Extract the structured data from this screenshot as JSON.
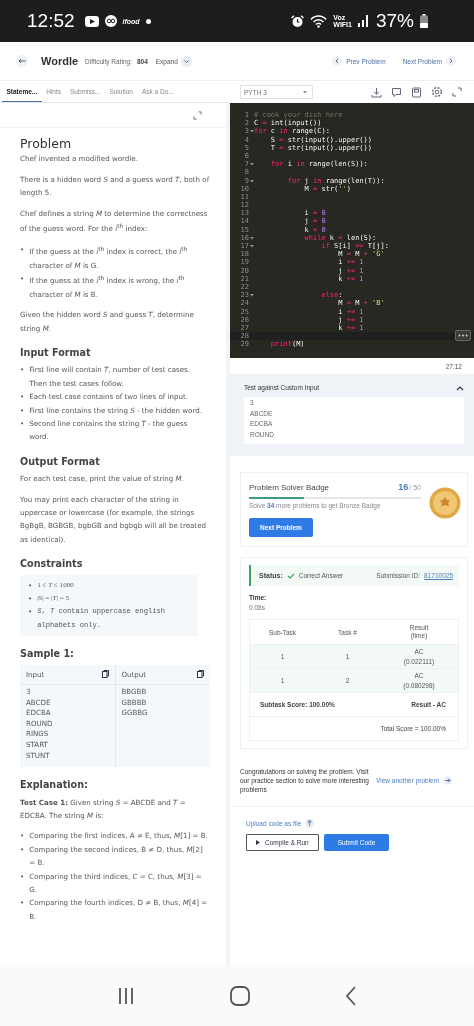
{
  "status_bar": {
    "time": "12:52",
    "notification_logo": "ifood",
    "carrier_top": "Voz",
    "carrier_bottom": "WIFI1",
    "battery": "37%"
  },
  "header": {
    "title": "Wordle",
    "difficulty_label": "Difficulty Rating:",
    "difficulty": "804",
    "expand": "Expand",
    "prev": "Prev Problem",
    "next": "Next Problem"
  },
  "tabs": [
    {
      "label": "Stateme...",
      "selected": true
    },
    {
      "label": "Hints",
      "selected": false
    },
    {
      "label": "Submiss...",
      "selected": false
    },
    {
      "label": "Solution",
      "selected": false
    },
    {
      "label": "Ask a Do...",
      "selected": false
    }
  ],
  "language": "PYTH 3",
  "statement": [
    {
      "kind": "title",
      "text": "Problem"
    },
    {
      "kind": "para",
      "text": "Chef invented a modified wordle."
    },
    {
      "kind": "para",
      "text": "There is a hidden word *S* and a guess word *T*, both of length 5."
    },
    {
      "kind": "para",
      "text": "Chef defines a string *M* to determine the correctness of the guess word. For the *i*$^{th}$ index:"
    },
    {
      "kind": "bullets",
      "marker": "•",
      "items": [
        "If the guess at the *i*$^{th}$ index is correct, the *i*$^{th}$ character of *M* is G.",
        "If the guess at the *i*$^{th}$ index is wrong, the *i*$^{th}$ character of *M* is B."
      ]
    },
    {
      "kind": "para",
      "text": "Given the hidden word *S* and guess *T*, determine string *M*."
    },
    {
      "kind": "heading",
      "text": "Input Format"
    },
    {
      "kind": "bullets",
      "marker": "•",
      "items": [
        "First line will contain *T*, number of test cases. Then the test cases follow.",
        "Each test case contains of two lines of input.",
        "First line contains the string *S* - the hidden word.",
        "Second line contains the string *T* - the guess word."
      ]
    },
    {
      "kind": "heading",
      "text": "Output Format"
    },
    {
      "kind": "para",
      "text": "For each test case, print the value of string *M*."
    },
    {
      "kind": "para",
      "text": "You may print each character of the string in uppercase or lowercase (for example, the strings BgBgB, BGBGB, bgbGB and bgbgb will all be treated as identical)."
    },
    {
      "kind": "heading",
      "text": "Constraints"
    },
    {
      "kind": "constraints",
      "marker": "•",
      "items": [
        {
          "kind": "math",
          "text": "1 ≤ *T* ≤ 1000"
        },
        {
          "kind": "math",
          "text": "|*S*| = |*T*| = 5"
        },
        {
          "kind": "code",
          "text": "*S*, *T* contain uppercase english alphabets only."
        }
      ]
    },
    {
      "kind": "heading",
      "text": "Sample 1:"
    },
    {
      "kind": "sample",
      "input_label": "Input",
      "output_label": "Output",
      "input": [
        "3",
        "ABCDE",
        "EDCBA",
        "ROUND",
        "RINGS",
        "START",
        "STUNT"
      ],
      "output": [
        "BBGBB",
        "GBBBB",
        "GGBBG"
      ]
    },
    {
      "kind": "heading",
      "text": "Explanation:"
    },
    {
      "kind": "para",
      "text": "**Test Case 1:** Given string *S* = ABCDE and *T* = EDCBA. The string *M* is:"
    },
    {
      "kind": "bullets",
      "marker": "•",
      "items": [
        "Comparing the first indices, A ≠ E, thus, *M*[1] = B.",
        "Comparing the second indices, B ≠ D, thus, *M*[2] = B.",
        "Comparing the third indices, C = C, thus, *M*[3] = G.",
        "Comparing the fourth indices, D ≠ B, thus, *M*[4] = B."
      ]
    }
  ],
  "code": [
    {
      "n": "1",
      "tokens": [
        {
          "text": "# cook your dish here",
          "kind": "comment"
        }
      ]
    },
    {
      "n": "2",
      "tokens": [
        {
          "text": "C ",
          "kind": "name"
        },
        {
          "text": "=",
          "kind": "operator"
        },
        {
          "text": " int(input())",
          "kind": "name"
        }
      ]
    },
    {
      "n": "3",
      "fold": true,
      "tokens": [
        {
          "text": "for",
          "kind": "keyword"
        },
        {
          "text": " c ",
          "kind": "name"
        },
        {
          "text": "in",
          "kind": "keyword"
        },
        {
          "text": " range(C):",
          "kind": "name"
        }
      ]
    },
    {
      "n": "4",
      "tokens": [
        {
          "text": "    S ",
          "kind": "name"
        },
        {
          "text": "=",
          "kind": "operator"
        },
        {
          "text": " str(input().upper())",
          "kind": "name"
        }
      ]
    },
    {
      "n": "5",
      "tokens": [
        {
          "text": "    T ",
          "kind": "name"
        },
        {
          "text": "=",
          "kind": "operator"
        },
        {
          "text": " str(input().upper())",
          "kind": "name"
        }
      ]
    },
    {
      "n": "6"
    },
    {
      "n": "7",
      "fold": true,
      "tokens": [
        {
          "text": "    for",
          "kind": "keyword"
        },
        {
          "text": " i ",
          "kind": "name"
        },
        {
          "text": "in",
          "kind": "keyword"
        },
        {
          "text": " range(len(S)):",
          "kind": "name"
        }
      ]
    },
    {
      "n": "8"
    },
    {
      "n": "9",
      "fold": true,
      "tokens": [
        {
          "text": "        for",
          "kind": "keyword"
        },
        {
          "text": " j ",
          "kind": "name"
        },
        {
          "text": "in",
          "kind": "keyword"
        },
        {
          "text": " range(len(T)):",
          "kind": "name"
        }
      ]
    },
    {
      "n": "10",
      "tokens": [
        {
          "text": "            M ",
          "kind": "name"
        },
        {
          "text": "=",
          "kind": "operator"
        },
        {
          "text": " str(",
          "kind": "name"
        },
        {
          "text": "''",
          "kind": "string"
        },
        {
          "text": ")",
          "kind": "name"
        }
      ]
    },
    {
      "n": "11"
    },
    {
      "n": "12"
    },
    {
      "n": "13",
      "tokens": [
        {
          "text": "            i ",
          "kind": "name"
        },
        {
          "text": "=",
          "kind": "operator"
        },
        {
          "text": " 0",
          "kind": "number"
        }
      ]
    },
    {
      "n": "14",
      "tokens": [
        {
          "text": "            j ",
          "kind": "name"
        },
        {
          "text": "=",
          "kind": "operator"
        },
        {
          "text": " 0",
          "kind": "number"
        }
      ]
    },
    {
      "n": "15",
      "tokens": [
        {
          "text": "            k ",
          "kind": "name"
        },
        {
          "text": "=",
          "kind": "operator"
        },
        {
          "text": " 0",
          "kind": "number"
        }
      ]
    },
    {
      "n": "16",
      "fold": true,
      "tokens": [
        {
          "text": "            while",
          "kind": "keyword"
        },
        {
          "text": " k ",
          "kind": "name"
        },
        {
          "text": "=",
          "kind": "operator"
        },
        {
          "text": " len(S):",
          "kind": "name"
        }
      ]
    },
    {
      "n": "17",
      "fold": true,
      "tokens": [
        {
          "text": "                if",
          "kind": "keyword"
        },
        {
          "text": " S[i] ",
          "kind": "name"
        },
        {
          "text": "==",
          "kind": "operator"
        },
        {
          "text": " T[j]:",
          "kind": "name"
        }
      ]
    },
    {
      "n": "18",
      "tokens": [
        {
          "text": "                    M ",
          "kind": "name"
        },
        {
          "text": "=",
          "kind": "operator"
        },
        {
          "text": " M ",
          "kind": "name"
        },
        {
          "text": "+",
          "kind": "operator"
        },
        {
          "text": " 'G'",
          "kind": "string"
        }
      ]
    },
    {
      "n": "19",
      "tokens": [
        {
          "text": "                    i ",
          "kind": "name"
        },
        {
          "text": "+=",
          "kind": "operator"
        },
        {
          "text": " 1",
          "kind": "number"
        }
      ]
    },
    {
      "n": "20",
      "tokens": [
        {
          "text": "                    j ",
          "kind": "name"
        },
        {
          "text": "+=",
          "kind": "operator"
        },
        {
          "text": " 1",
          "kind": "number"
        }
      ]
    },
    {
      "n": "21",
      "tokens": [
        {
          "text": "                    k ",
          "kind": "name"
        },
        {
          "text": "+=",
          "kind": "operator"
        },
        {
          "text": " 1",
          "kind": "number"
        }
      ]
    },
    {
      "n": "22"
    },
    {
      "n": "23",
      "fold": true,
      "tokens": [
        {
          "text": "                else",
          "kind": "keyword"
        },
        {
          "text": ":",
          "kind": "name"
        }
      ]
    },
    {
      "n": "24",
      "tokens": [
        {
          "text": "                    M ",
          "kind": "name"
        },
        {
          "text": "=",
          "kind": "operator"
        },
        {
          "text": " M ",
          "kind": "name"
        },
        {
          "text": "+",
          "kind": "operator"
        },
        {
          "text": " 'B'",
          "kind": "string"
        }
      ]
    },
    {
      "n": "25",
      "tokens": [
        {
          "text": "                    i ",
          "kind": "name"
        },
        {
          "text": "+=",
          "kind": "operator"
        },
        {
          "text": " 1",
          "kind": "number"
        }
      ]
    },
    {
      "n": "26",
      "tokens": [
        {
          "text": "                    j ",
          "kind": "name"
        },
        {
          "text": "+=",
          "kind": "operator"
        },
        {
          "text": " 1",
          "kind": "number"
        }
      ]
    },
    {
      "n": "27",
      "tokens": [
        {
          "text": "                    k ",
          "kind": "name"
        },
        {
          "text": "+=",
          "kind": "operator"
        },
        {
          "text": " 1",
          "kind": "number"
        }
      ]
    },
    {
      "n": "28",
      "active": true
    },
    {
      "n": "29",
      "tokens": [
        {
          "text": "    print",
          "kind": "keyword"
        },
        {
          "text": "(M)",
          "kind": "name"
        }
      ]
    }
  ],
  "timer": "27:12",
  "custom_input": {
    "title": "Test against Custom Input",
    "expanded": true,
    "lines": [
      "3",
      "ABCDE",
      "EDCBA",
      "ROUND"
    ]
  },
  "badge": {
    "title": "Problem Solver Badge",
    "count": "16",
    "total": "/ 50",
    "level": 0.32,
    "hint": "Solve **34** more problems to get Bronze Badge",
    "button": "Next Problem"
  },
  "result": {
    "status_label": "Status:",
    "status": "Correct Answer",
    "submission_label": "Submission ID:",
    "submission_id": "81710025",
    "time_label": "Time:",
    "time": "0.08s",
    "columns": [
      "Sub-Task",
      "Task #",
      "Result (time)"
    ],
    "rows": [
      {
        "subtask": "1",
        "task": "1",
        "result": "AC",
        "time": "(0.022111)"
      },
      {
        "subtask": "1",
        "task": "2",
        "result": "AC",
        "time": "(0.080298)"
      }
    ],
    "subtask_score": "Subtask Score: 100.00%",
    "result_summary": "Result - AC",
    "total_score": "Total Score = 100.00%"
  },
  "congrats": {
    "text": "Congratulations on solving the problem. Visit our practice section to solve more interesting problems",
    "link": "View another problem"
  },
  "actions": {
    "upload": "Upload code as file",
    "compile": "Compile & Run",
    "submit": "Submit Code"
  }
}
